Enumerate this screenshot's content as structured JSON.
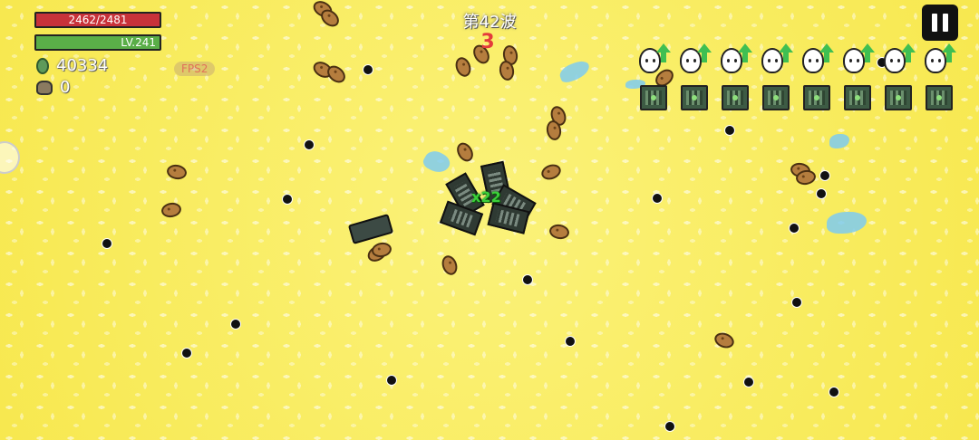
{
  "hud": {
    "hp_text": "2462/2481",
    "hp_fraction": 0.992,
    "level_text": "LV.241",
    "coins": "40334",
    "bags": "0",
    "fps": "FPS2",
    "wave_title": "第42波",
    "enemy_count": "3",
    "combo_text": "x22",
    "colors": {
      "hp": "#c8323a",
      "level": "#5aae48",
      "count": "#e43b3b",
      "combo": "#3ccf3a"
    }
  },
  "upgrades": {
    "egg_icon": "egg-upgrade-icon",
    "count": 8
  },
  "crates": {
    "icon": "crate-icon",
    "count": 8
  }
}
